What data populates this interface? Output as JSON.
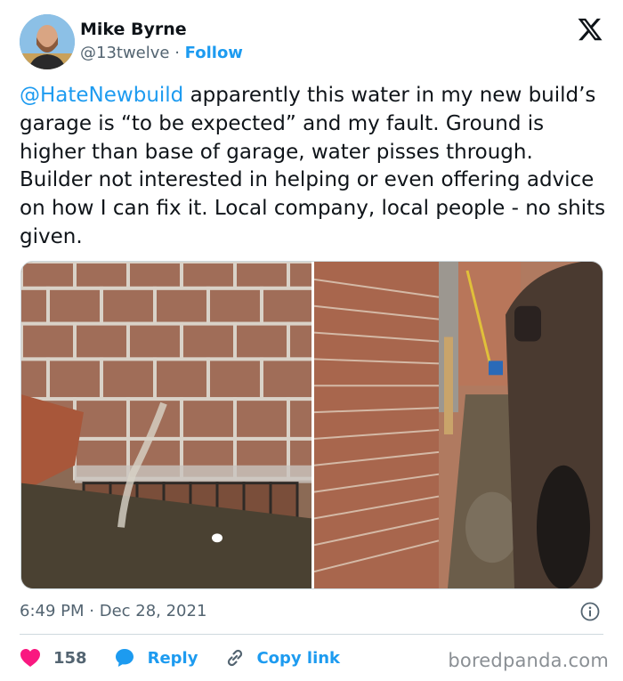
{
  "user": {
    "name": "Mike Byrne",
    "handle": "@13twelve",
    "separator": " · ",
    "follow_label": "Follow"
  },
  "tweet": {
    "mention": "@HateNewbuild",
    "text": " apparently this water in my new build’s garage is “to be expected” and my fault. Ground is higher than base of garage, water pisses through. Builder not interested in helping or even offering advice on how I can fix it. Local company, local people - no shits given.",
    "time": "6:49 PM",
    "date_sep": " · ",
    "date": "Dec 28, 2021"
  },
  "actions": {
    "like_count": "158",
    "reply_label": "Reply",
    "copy_label": "Copy link"
  },
  "watermark": "boredpanda.com",
  "colors": {
    "accent": "#1d9bf0",
    "like": "#f91880",
    "text": "#0f1419",
    "muted": "#536471"
  },
  "icons": {
    "logo": "x-logo-icon",
    "info": "info-icon",
    "like": "heart-icon",
    "reply": "speech-bubble-icon",
    "copy": "link-icon"
  }
}
